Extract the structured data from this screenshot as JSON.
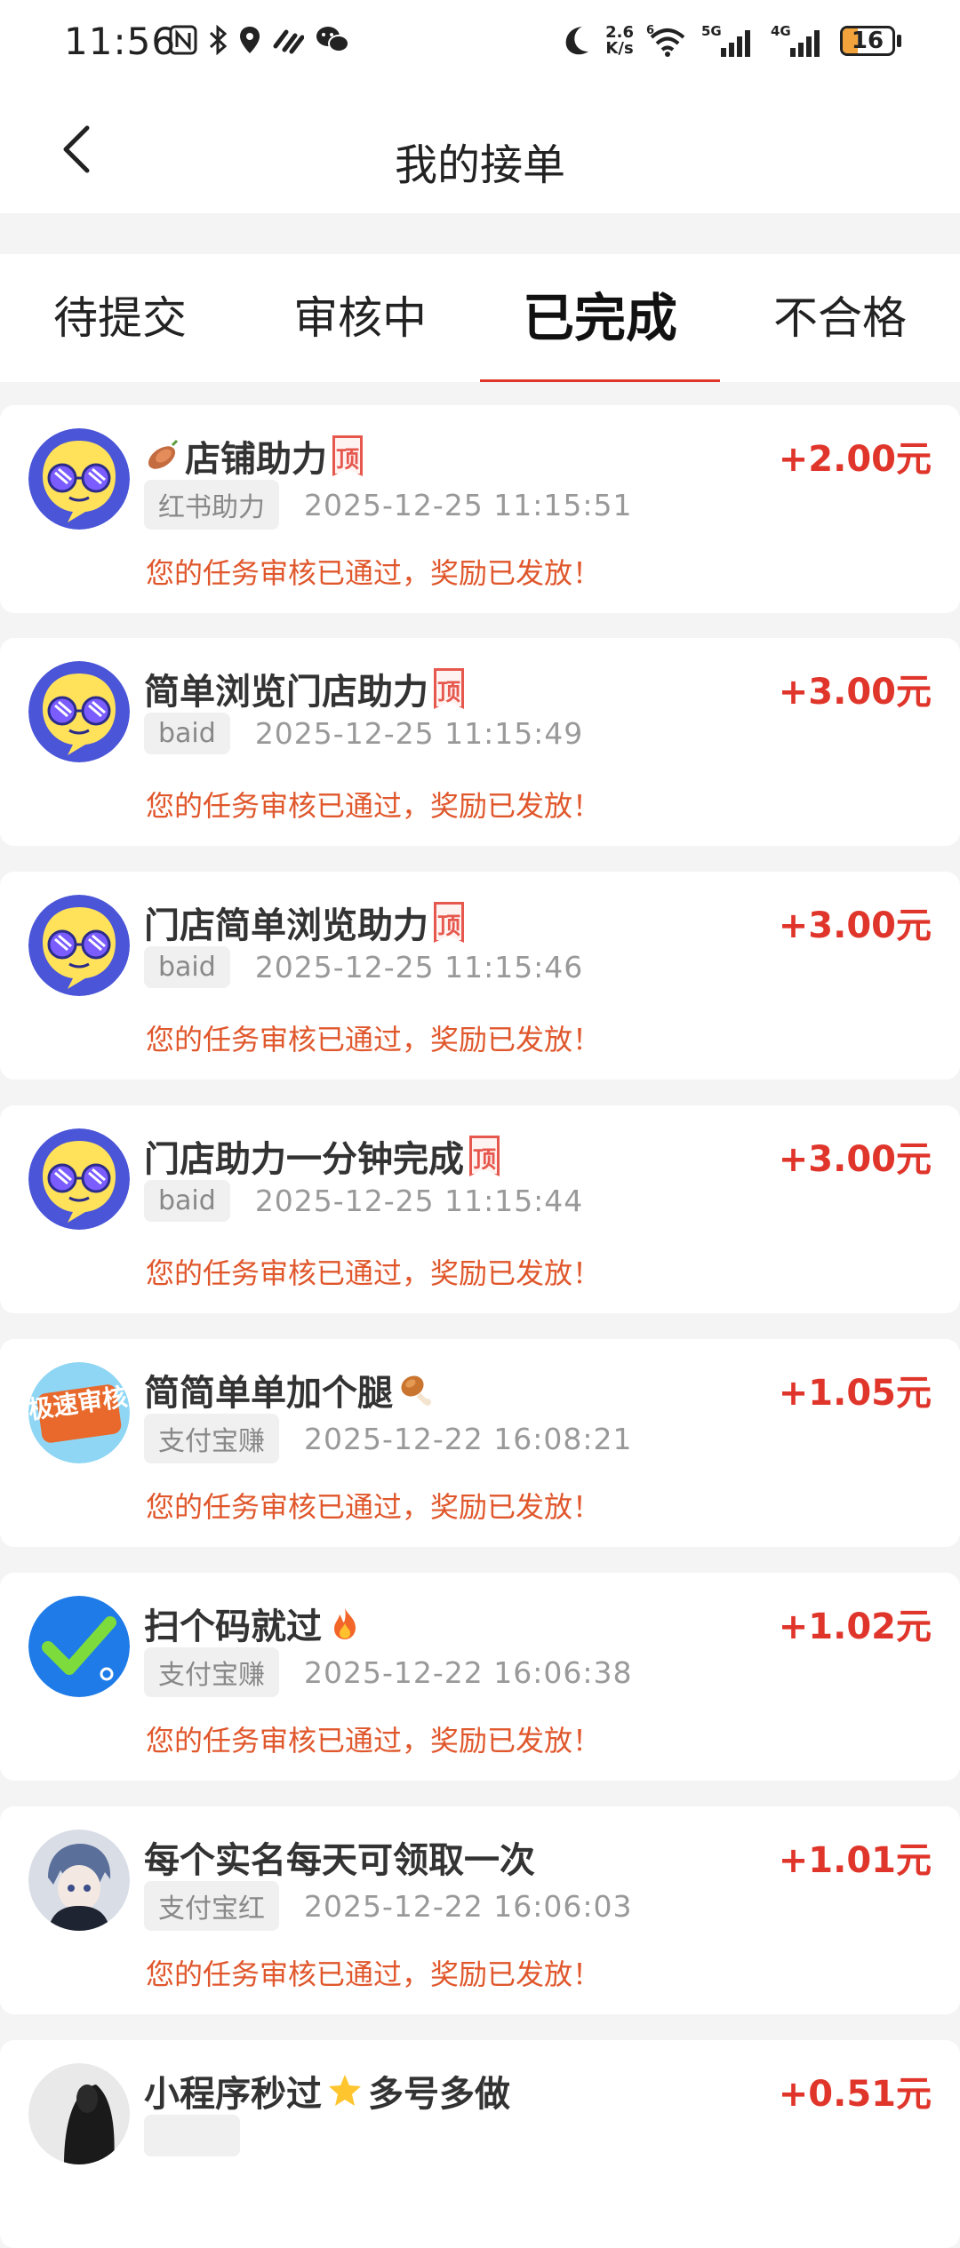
{
  "status_bar": {
    "time": "11:56",
    "speed_top": "2.6",
    "speed_bottom": "K/s",
    "wifi_label": "6",
    "net1": "5G",
    "net2": "4G",
    "battery": "16"
  },
  "header": {
    "title": "我的接单"
  },
  "tabs": [
    {
      "label": "待提交"
    },
    {
      "label": "审核中"
    },
    {
      "label": "已完成"
    },
    {
      "label": "不合格"
    }
  ],
  "active_tab": "已完成",
  "orders": [
    {
      "title": "店铺助力",
      "platform": "红书助力",
      "time": "2025-12-25 11:15:51",
      "status": "您的任务审核已通过，奖励已发放！",
      "reward": "+2.00元",
      "top_badge": "顶"
    },
    {
      "title": "简单浏览门店助力",
      "platform": "baid",
      "time": "2025-12-25 11:15:49",
      "status": "您的任务审核已通过，奖励已发放！",
      "reward": "+3.00元",
      "top_badge": "顶"
    },
    {
      "title": "门店简单浏览助力",
      "platform": "baid",
      "time": "2025-12-25 11:15:46",
      "status": "您的任务审核已通过，奖励已发放！",
      "reward": "+3.00元",
      "top_badge": "顶"
    },
    {
      "title": "门店助力一分钟完成",
      "platform": "baid",
      "time": "2025-12-25 11:15:44",
      "status": "您的任务审核已通过，奖励已发放！",
      "reward": "+3.00元",
      "top_badge": "顶"
    },
    {
      "title": "简简单单加个腿",
      "platform": "支付宝赚",
      "time": "2025-12-22 16:08:21",
      "status": "您的任务审核已通过，奖励已发放！",
      "reward": "+1.05元",
      "avatar_text": "极速审核"
    },
    {
      "title": "扫个码就过",
      "platform": "支付宝赚",
      "time": "2025-12-22 16:06:38",
      "status": "您的任务审核已通过，奖励已发放！",
      "reward": "+1.02元"
    },
    {
      "title": "每个实名每天可领取一次",
      "platform": "支付宝红",
      "time": "2025-12-22 16:06:03",
      "status": "您的任务审核已通过，奖励已发放！",
      "reward": "+1.01元"
    },
    {
      "title": "小程序秒过",
      "title_suffix": "多号多做",
      "reward": "+0.51元"
    }
  ],
  "colors": {
    "accent_red": "#e0352b",
    "status_orange": "#e0572c",
    "tag_bg": "#f0f0f0"
  }
}
